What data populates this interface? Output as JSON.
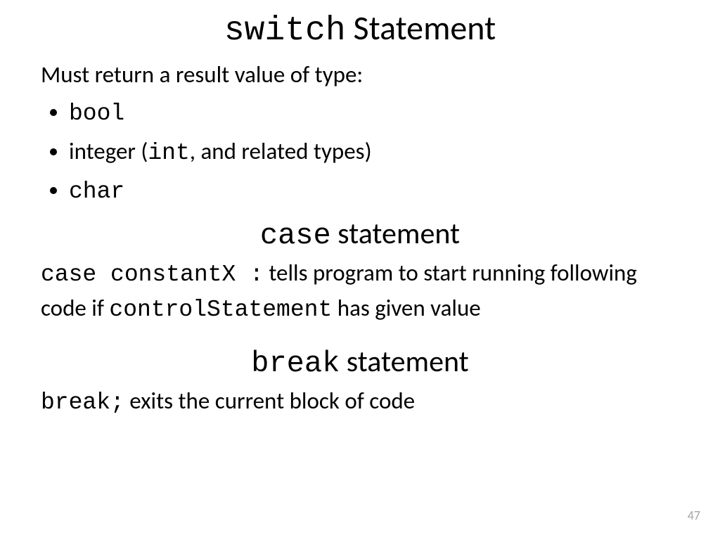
{
  "heading1": {
    "code": "switch",
    "rest": " Statement"
  },
  "intro": "Must return a result value of type:",
  "bullets": {
    "b1": "bool",
    "b2": {
      "prefix": "integer (",
      "code": "int",
      "suffix": ", and related types)"
    },
    "b3": "char"
  },
  "heading2": {
    "code": "case",
    "rest": " statement"
  },
  "para1": {
    "code1": "case constantX :",
    "mid": " tells program to start running following code if ",
    "code2": "controlStatement",
    "end": " has given value"
  },
  "heading3": {
    "code": "break",
    "rest": " statement"
  },
  "para2": {
    "code": "break;",
    "rest": " exits the current block of code"
  },
  "page": "47"
}
